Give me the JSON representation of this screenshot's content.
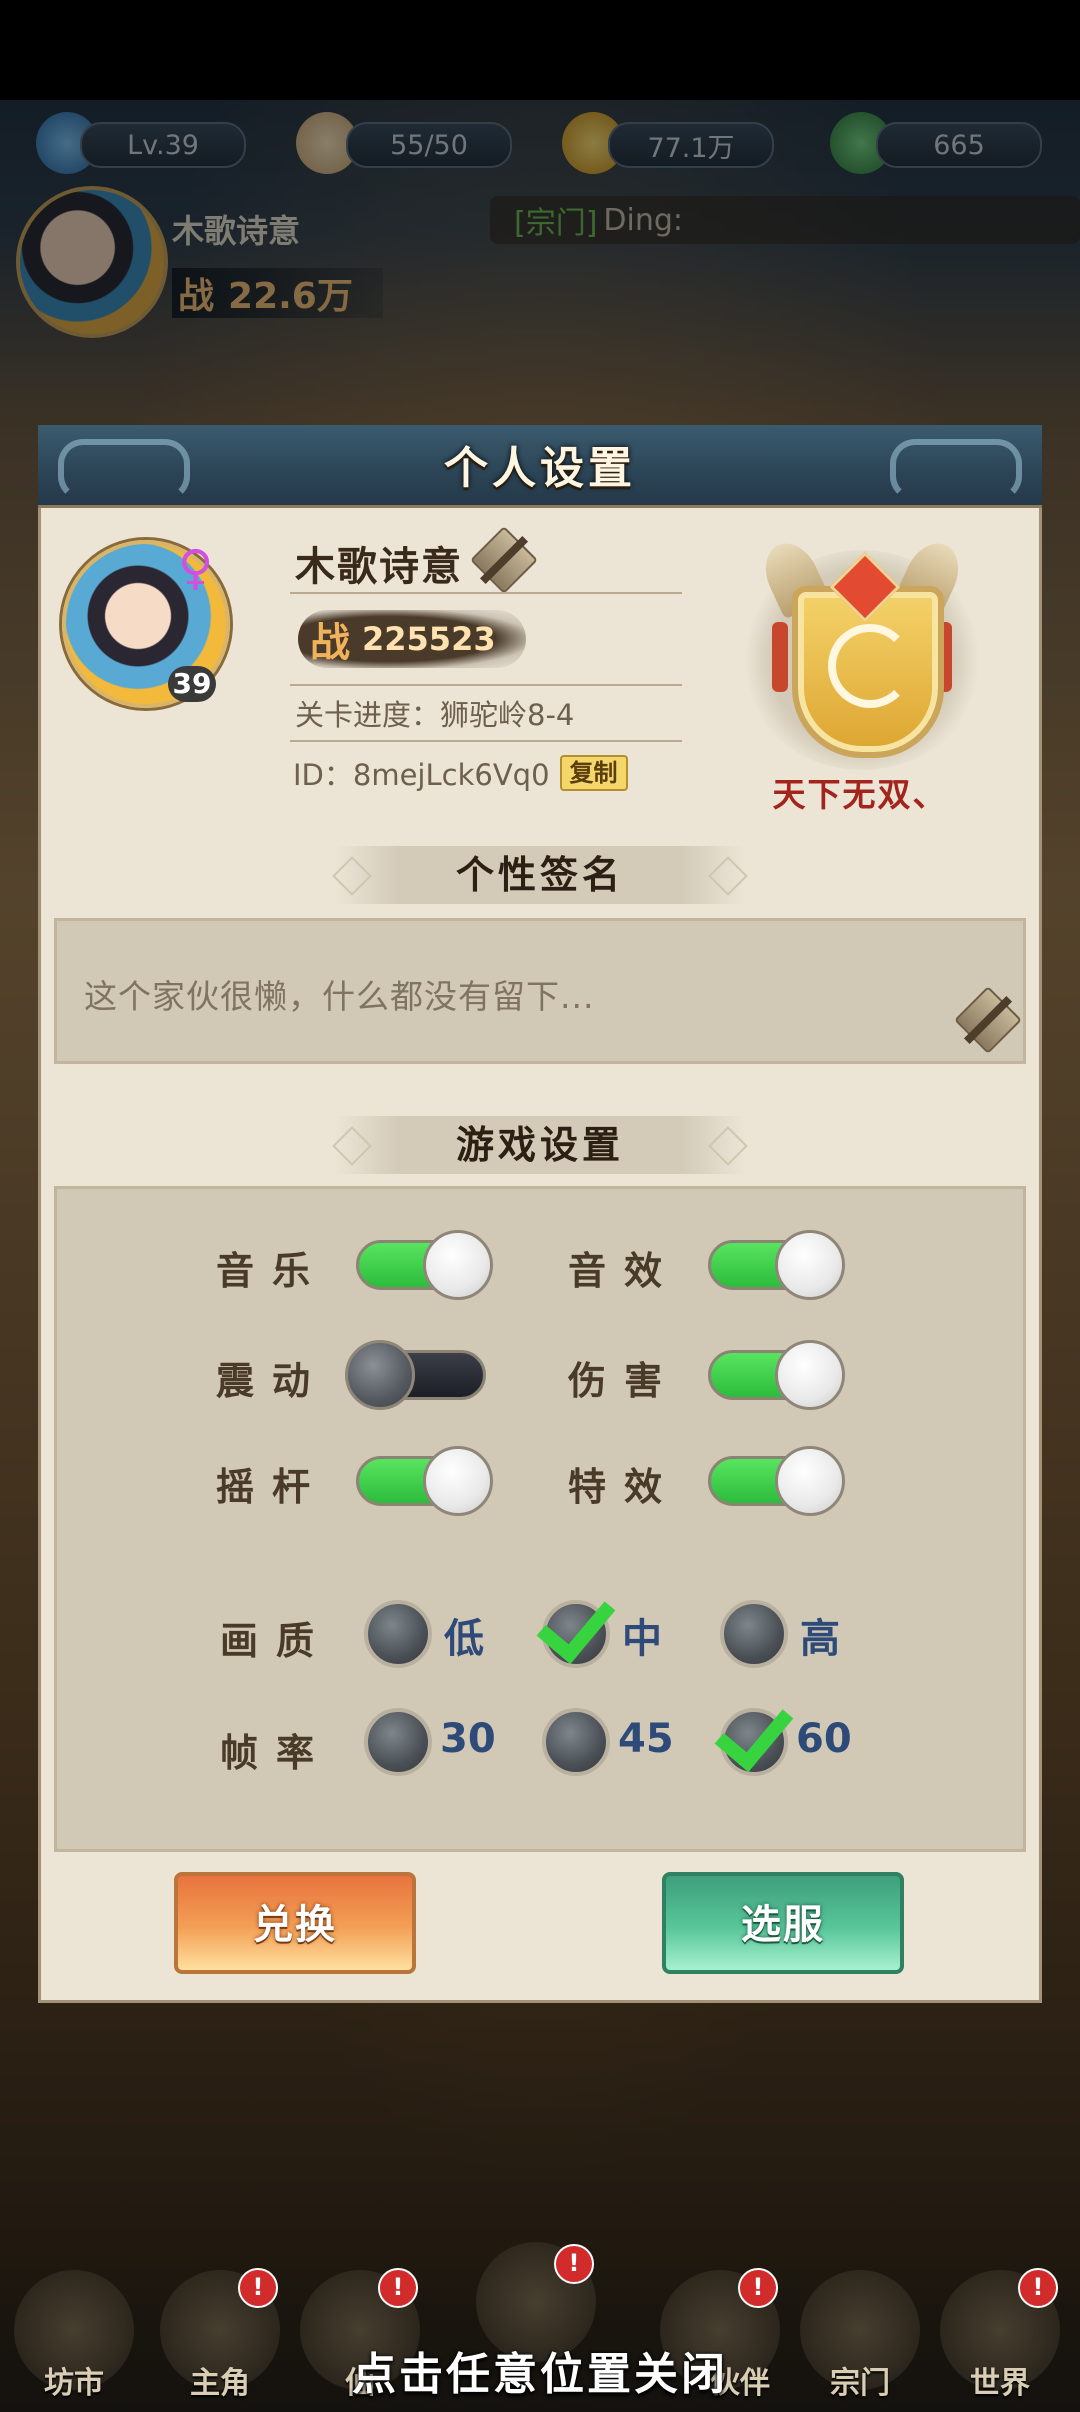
{
  "hud": {
    "level": "Lv.39",
    "stamina": "55/50",
    "coins": "77.1万",
    "jade": "665",
    "player_name": "木歌诗意",
    "power_icon": "战",
    "power": "22.6万",
    "chat_tag": "[宗门]",
    "chat_text": "Ding:"
  },
  "panel": {
    "title": "个人设置",
    "gender_symbol": "♀",
    "avatar_level": "39",
    "name": "木歌诗意",
    "power_icon": "战",
    "power": "225523",
    "progress": "关卡进度：狮驼岭8-4",
    "id_text": "ID：8mejLck6Vq0",
    "copy_label": "复制",
    "honor_title": "天下无双、"
  },
  "signature": {
    "header": "个性签名",
    "text": "这个家伙很懒，什么都没有留下..."
  },
  "game_settings": {
    "header": "游戏设置",
    "toggles": [
      {
        "label": "音乐",
        "on": true
      },
      {
        "label": "音效",
        "on": true
      },
      {
        "label": "震动",
        "on": false
      },
      {
        "label": "伤害",
        "on": true
      },
      {
        "label": "摇杆",
        "on": true
      },
      {
        "label": "特效",
        "on": true
      }
    ],
    "quality": {
      "label": "画质",
      "options": [
        "低",
        "中",
        "高"
      ],
      "selected": "中"
    },
    "frame_rate": {
      "label": "帧率",
      "options": [
        "30",
        "45",
        "60"
      ],
      "selected": "60"
    }
  },
  "buttons": {
    "exchange": "兑换",
    "select_server": "选服"
  },
  "bottom_nav": {
    "items": [
      "坊市",
      "主角",
      "仙",
      "",
      "伙伴",
      "宗门",
      "世界"
    ],
    "badge": "!"
  },
  "close_hint": "点击任意位置关闭"
}
